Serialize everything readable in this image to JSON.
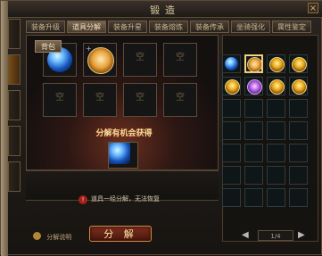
{
  "window": {
    "title": "锻造"
  },
  "side_tabs": [
    "",
    "",
    "",
    "",
    ""
  ],
  "tabs": [
    {
      "label": "装备升级",
      "active": false
    },
    {
      "label": "道具分解",
      "active": true
    },
    {
      "label": "装备升星",
      "active": false
    },
    {
      "label": "装备熔炼",
      "active": false
    },
    {
      "label": "装备传承",
      "active": false
    },
    {
      "label": "坐骑强化",
      "active": false
    },
    {
      "label": "属性鉴定",
      "active": false
    }
  ],
  "panel": {
    "title": "分解有机会获得",
    "hint": "道具一经分解，无法恢复",
    "help_label": "分解说明",
    "button_label": "分 解"
  },
  "right_panel": {
    "tab_label": "背包",
    "page": "1/4"
  },
  "items": {
    "decompose_slots": [
      {
        "type": "blue",
        "plus": "+"
      },
      {
        "type": "face",
        "plus": "+"
      },
      {
        "type": "empty"
      },
      {
        "type": "empty"
      },
      {
        "type": "empty"
      },
      {
        "type": "empty"
      },
      {
        "type": "empty"
      },
      {
        "type": "empty"
      }
    ],
    "reward": {
      "type": "blue"
    },
    "bag": [
      {
        "type": "blue"
      },
      {
        "type": "face",
        "selected": true
      },
      {
        "type": "gold"
      },
      {
        "type": "gold"
      },
      {
        "type": "gold"
      },
      {
        "type": "purple"
      },
      {
        "type": "gold"
      },
      {
        "type": "gold"
      }
    ]
  }
}
